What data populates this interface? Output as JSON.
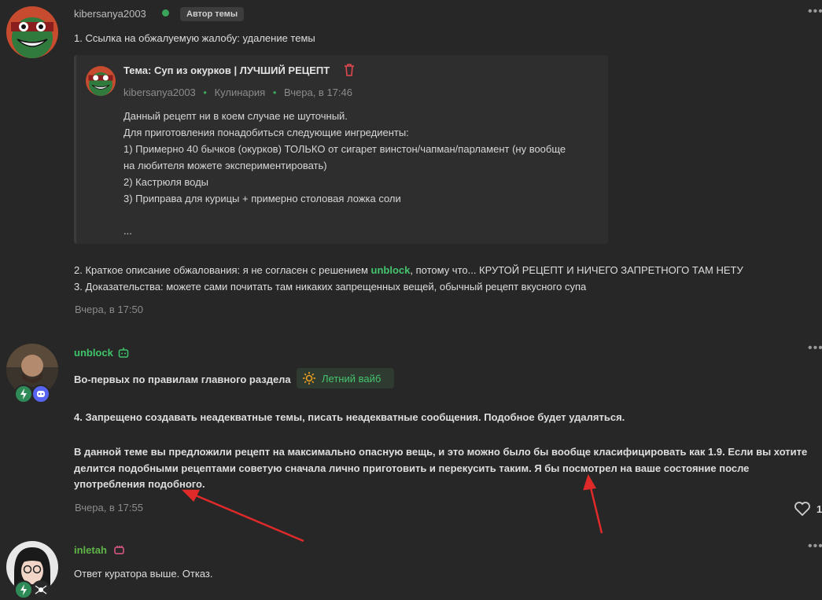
{
  "post1": {
    "username": "kibersanya2003",
    "author_badge": "Автор темы",
    "lines": [
      "1. Ссылка на обжалуемую жалобу: удаление темы"
    ],
    "quote": {
      "title": "Тема: Суп из окурков | ЛУЧШИЙ РЕЦЕПТ",
      "author": "kibersanya2003",
      "sep1": "•",
      "category": "Кулинария",
      "sep2": "•",
      "time": "Вчера, в 17:46",
      "body": [
        "Данный рецепт ни в коем случае не шуточный.",
        "Для приготовления понадобиться следующие ингредиенты:",
        "1) Примерно 40 бычков (окурков) ТОЛЬКО от сигарет винстон/чапман/парламент (ну вообще",
        "на любителя можете экспериментировать)",
        "2) Кастрюля воды",
        "3) Приправа для курицы + примерно столовая ложка соли",
        "..."
      ]
    },
    "line2_before": "2. Краткое описание обжалования: я не согласен с решением ",
    "line2_link": "unblock",
    "line2_after": ", потому что... КРУТОЙ РЕЦЕПТ И НИЧЕГО ЗАПРЕТНОГО ТАМ НЕТУ",
    "line3": "3. Доказательства: можете сами почитать там никаких запрещенных вещей, обычный рецепт вкусного супа",
    "timestamp": "Вчера, в 17:50"
  },
  "post2": {
    "username": "unblock",
    "intro_text": "Во-первых по правилам главного раздела",
    "section_tag": "Летний вайб",
    "rule": "4. Запрещено создавать неадекватные темы, писать неадекватные сообщения. Подобное будет удаляться.",
    "body": [
      "В данной теме вы предложили рецепт на максимально опасную вещь, и это можно было бы вообще класифицировать как 1.9. Если вы хотите",
      "делится подобными рецептами советую сначала лично приготовить и перекусить таким. Я бы посмотрел на ваше состояние после",
      "употребления подобного."
    ],
    "timestamp": "Вчера, в 17:55",
    "like_count": "1"
  },
  "post3": {
    "username": "inletah",
    "text": "Ответ куратора выше. Отказ."
  },
  "colors": {
    "background": "#272727",
    "quote_bg": "#2e2e2e",
    "green_name": "#3fc46a",
    "link_green": "#45c46e",
    "inletah_name": "#5fb548",
    "arrow_red": "#e02a2a",
    "delete_red": "#e0484e"
  },
  "icons": [
    "menu-dots-icon",
    "trash-icon",
    "bot-icon",
    "sun-icon",
    "heart-icon",
    "fist-icon",
    "lightning-icon",
    "discord-icon",
    "spider-icon"
  ]
}
